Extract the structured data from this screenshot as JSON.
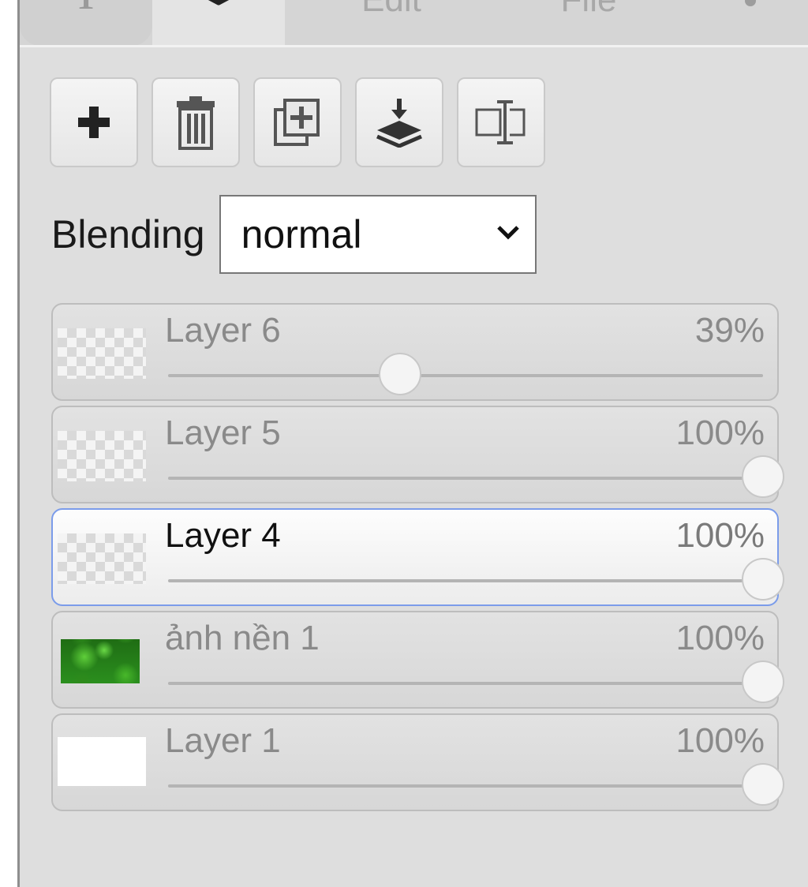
{
  "tabs": {
    "text_icon": "text-tool-icon",
    "layers_icon": "layers-icon",
    "edit": "Edit",
    "file": "File",
    "more_icon": "more-vertical-icon",
    "active": "layers"
  },
  "toolbar": {
    "buttons": [
      {
        "icon": "plus-icon"
      },
      {
        "icon": "trash-icon"
      },
      {
        "icon": "duplicate-icon"
      },
      {
        "icon": "merge-down-icon"
      },
      {
        "icon": "rename-icon"
      }
    ]
  },
  "blending": {
    "label": "Blending",
    "value": "normal"
  },
  "layers": [
    {
      "name": "Layer 6",
      "opacity_label": "39%",
      "opacity": 0.39,
      "thumb": "transparent",
      "selected": false
    },
    {
      "name": "Layer 5",
      "opacity_label": "100%",
      "opacity": 1.0,
      "thumb": "transparent",
      "selected": false
    },
    {
      "name": "Layer 4",
      "opacity_label": "100%",
      "opacity": 1.0,
      "thumb": "transparent",
      "selected": true
    },
    {
      "name": "ảnh nền 1",
      "opacity_label": "100%",
      "opacity": 1.0,
      "thumb": "green-image",
      "selected": false
    },
    {
      "name": "Layer 1",
      "opacity_label": "100%",
      "opacity": 1.0,
      "thumb": "white",
      "selected": false
    }
  ],
  "colors": {
    "selected_border": "#7b9cea",
    "panel_bg": "#dedede"
  }
}
